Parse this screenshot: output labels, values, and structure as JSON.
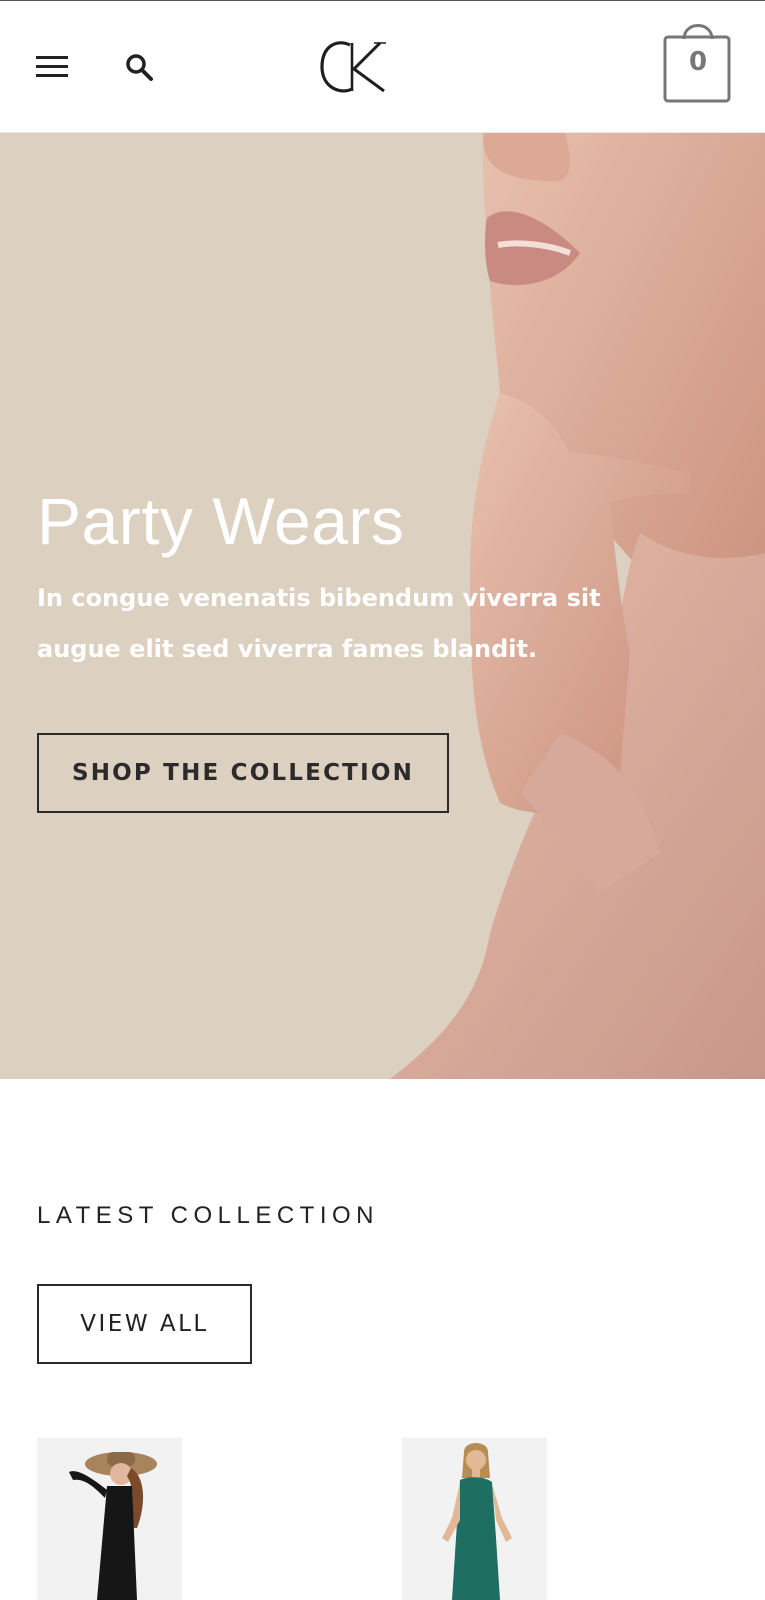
{
  "header": {
    "menu_icon": "hamburger-menu-icon",
    "search_icon": "search-icon",
    "logo_text": "CK",
    "cart_icon": "shopping-bag-icon",
    "cart_count": "0"
  },
  "hero": {
    "title": "Party Wears",
    "subtitle": "In congue venenatis bibendum viverra sit augue elit sed viverra fames blandit.",
    "cta_label": "SHOP THE COLLECTION",
    "background_color": "#dcd0c0"
  },
  "latest": {
    "title": "LATEST COLLECTION",
    "view_all_label": "VIEW ALL"
  },
  "products": [
    {
      "image": "woman-black-outfit-hat-photo"
    },
    {
      "image": "woman-teal-sequin-dress-photo"
    }
  ],
  "colors": {
    "text_dark": "#222222",
    "hero_bg": "#dcd0c0",
    "cart_icon": "#777777"
  }
}
